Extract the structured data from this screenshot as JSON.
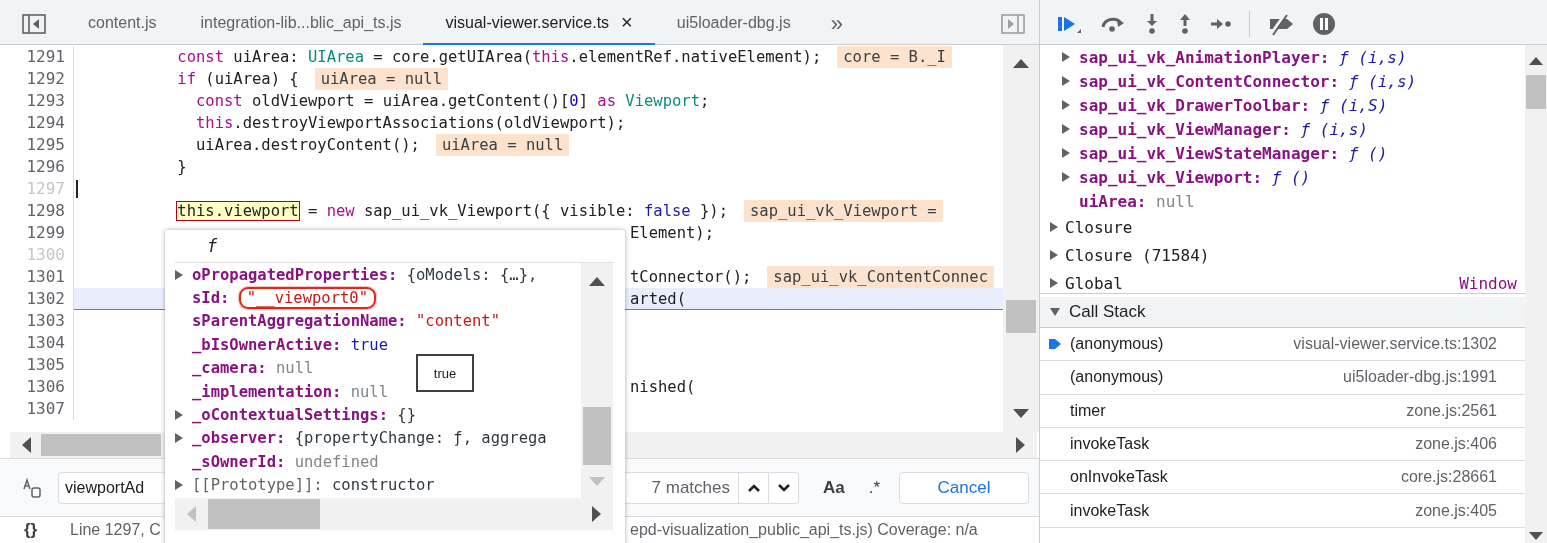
{
  "editor": {
    "tabs": [
      {
        "label": "content.js",
        "selected": false
      },
      {
        "label": "integration-lib...blic_api_ts.js",
        "selected": false
      },
      {
        "label": "visual-viewer.service.ts",
        "selected": true,
        "close": "×"
      },
      {
        "label": "ui5loader-dbg.js",
        "selected": false
      }
    ],
    "overflow": "»",
    "lines": [
      {
        "number": "1291",
        "dimmed": false,
        "current": false,
        "covered": false,
        "cursor": false,
        "tokens": [
          {
            "t": "          const",
            "kind": "kw"
          },
          {
            "t": " uiArea: ",
            "kind": "plain"
          },
          {
            "t": "UIArea",
            "kind": "type"
          },
          {
            "t": " = core.getUIArea(",
            "kind": "plain"
          },
          {
            "t": "this",
            "kind": "kw"
          },
          {
            "t": ".elementRef.nativeElement);",
            "kind": "plain"
          }
        ],
        "inline_value": "core = B._I"
      },
      {
        "number": "1292",
        "dimmed": false,
        "current": false,
        "covered": false,
        "cursor": false,
        "tokens": [
          {
            "t": "          if",
            "kind": "kw"
          },
          {
            "t": " (uiArea) {",
            "kind": "plain"
          }
        ],
        "inline_value": "uiArea = null"
      },
      {
        "number": "1293",
        "dimmed": false,
        "current": false,
        "covered": false,
        "cursor": false,
        "tokens": [
          {
            "t": "            const",
            "kind": "kw"
          },
          {
            "t": " oldViewport = uiArea.getContent()[",
            "kind": "plain"
          },
          {
            "t": "0",
            "kind": "num"
          },
          {
            "t": "] ",
            "kind": "plain"
          },
          {
            "t": "as",
            "kind": "kw"
          },
          {
            "t": " Viewport",
            "kind": "type"
          },
          {
            "t": ";",
            "kind": "plain"
          }
        ]
      },
      {
        "number": "1294",
        "dimmed": false,
        "current": false,
        "covered": false,
        "cursor": false,
        "tokens": [
          {
            "t": "            this",
            "kind": "kw"
          },
          {
            "t": ".destroyViewportAssociations(oldViewport);",
            "kind": "plain"
          }
        ]
      },
      {
        "number": "1295",
        "dimmed": false,
        "current": false,
        "covered": false,
        "cursor": false,
        "tokens": [
          {
            "t": "            uiArea.destroyContent();",
            "kind": "plain"
          }
        ],
        "inline_value": "uiArea = null"
      },
      {
        "number": "1296",
        "dimmed": false,
        "current": false,
        "covered": false,
        "cursor": false,
        "tokens": [
          {
            "t": "          }",
            "kind": "plain"
          }
        ]
      },
      {
        "number": "1297",
        "dimmed": true,
        "current": false,
        "covered": false,
        "cursor": true
      },
      {
        "number": "1298",
        "dimmed": false,
        "current": false,
        "covered": false,
        "cursor": false,
        "tokens": [
          {
            "t": "          this.viewport",
            "kind": "hl"
          },
          {
            "t": " = ",
            "kind": "plain"
          },
          {
            "t": "new",
            "kind": "kw"
          },
          {
            "t": " sap_ui_vk_Viewport({ visible: ",
            "kind": "plain"
          },
          {
            "t": "false",
            "kind": "bool"
          },
          {
            "t": " });",
            "kind": "plain"
          }
        ],
        "inline_value": "sap_ui_vk_Viewport ="
      },
      {
        "number": "1299",
        "dimmed": false,
        "current": false,
        "covered": true,
        "cursor": false,
        "tokens": [
          {
            "t": "Element);",
            "kind": "plain"
          }
        ]
      },
      {
        "number": "1300",
        "dimmed": true,
        "current": false,
        "cursor": false
      },
      {
        "number": "1301",
        "dimmed": false,
        "current": false,
        "covered": true,
        "cursor": false,
        "tokens": [
          {
            "t": "tConnector();",
            "kind": "plain"
          }
        ],
        "inline_value": "sap_ui_vk_ContentConnec"
      },
      {
        "number": "1302",
        "dimmed": false,
        "current": true,
        "covered": true,
        "cursor": false,
        "tokens": [
          {
            "t": "arted(",
            "kind": "plain"
          }
        ]
      },
      {
        "number": "1303",
        "dimmed": false,
        "current": false,
        "cursor": false
      },
      {
        "number": "1304",
        "dimmed": false,
        "current": false,
        "cursor": false
      },
      {
        "number": "1305",
        "dimmed": false,
        "current": false,
        "cursor": false
      },
      {
        "number": "1306",
        "dimmed": false,
        "current": false,
        "covered": true,
        "cursor": false,
        "tokens": [
          {
            "t": "nished(",
            "kind": "plain"
          }
        ]
      },
      {
        "number": "1307",
        "dimmed": false,
        "current": false,
        "cursor": false
      }
    ],
    "search": {
      "value": "viewportAd",
      "matches": "7 matches",
      "case_label": "Aa",
      "regex_label": ".*",
      "cancel": "Cancel"
    },
    "status": {
      "icon": "{}",
      "left": "Line 1297, C",
      "right": "epd-visualization_public_api_ts.js) Coverage: n/a"
    }
  },
  "popover": {
    "title": "f",
    "tooltip": "true",
    "rows": [
      {
        "key": "oPropagatedProperties:",
        "value": "{oModels: {…},",
        "kind": "object",
        "expandable": true,
        "circled": false,
        "internal": false
      },
      {
        "key": "sId:",
        "value": "\"__viewport0\"",
        "kind": "string",
        "expandable": false,
        "circled": true,
        "internal": false
      },
      {
        "key": "sParentAggregationName:",
        "value": "\"content\"",
        "kind": "string",
        "expandable": false,
        "circled": false,
        "internal": false
      },
      {
        "key": "_bIsOwnerActive:",
        "value": "true",
        "kind": "bool",
        "expandable": false,
        "circled": false,
        "internal": false
      },
      {
        "key": "_camera:",
        "value": "null",
        "kind": "null",
        "expandable": false,
        "circled": false,
        "internal": false
      },
      {
        "key": "_implementation:",
        "value": "null",
        "kind": "null",
        "expandable": false,
        "circled": false,
        "internal": false
      },
      {
        "key": "_oContextualSettings:",
        "value": "{}",
        "kind": "object",
        "expandable": true,
        "circled": false,
        "internal": false
      },
      {
        "key": "_observer:",
        "value": "{propertyChange: ƒ, aggrega",
        "kind": "object",
        "expandable": true,
        "circled": false,
        "internal": false
      },
      {
        "key": "_sOwnerId:",
        "value": "undefined",
        "kind": "null",
        "expandable": false,
        "circled": false,
        "internal": false
      },
      {
        "key": "[[Prototype]]:",
        "value": "constructor",
        "kind": "object",
        "expandable": true,
        "circled": false,
        "internal": true
      }
    ]
  },
  "scope": [
    {
      "children": [
        {
          "name": "sap_ui_vk_AnimationPlayer:",
          "value": "ƒ (i,s)",
          "kind": "fn",
          "expandable": true
        },
        {
          "name": "sap_ui_vk_ContentConnector:",
          "value": "ƒ (i,s)",
          "kind": "fn",
          "expandable": true
        },
        {
          "name": "sap_ui_vk_DrawerToolbar:",
          "value": "ƒ (i,S)",
          "kind": "fn",
          "expandable": true
        },
        {
          "name": "sap_ui_vk_ViewManager:",
          "value": "ƒ (i,s)",
          "kind": "fn",
          "expandable": true
        },
        {
          "name": "sap_ui_vk_ViewStateManager:",
          "value": "ƒ ()",
          "kind": "fn",
          "expandable": true
        },
        {
          "name": "sap_ui_vk_Viewport:",
          "value": "ƒ ()",
          "kind": "fn",
          "expandable": true
        },
        {
          "name": "uiArea:",
          "value": "null",
          "kind": "null",
          "expandable": false
        }
      ]
    },
    {
      "name": "Closure",
      "expandable": true
    },
    {
      "name": "Closure (71584)",
      "expandable": true
    },
    {
      "name": "Global",
      "value": "Window",
      "expandable": true
    }
  ],
  "call_stack": {
    "title": "Call Stack",
    "expanded": true,
    "frames": [
      {
        "function": "(anonymous)",
        "location": "visual-viewer.service.ts:1302",
        "selected": true
      },
      {
        "function": "(anonymous)",
        "location": "ui5loader-dbg.js:1991",
        "selected": false
      },
      {
        "function": "timer",
        "location": "zone.js:2561",
        "selected": false
      },
      {
        "function": "invokeTask",
        "location": "zone.js:406",
        "selected": false
      },
      {
        "function": "onInvokeTask",
        "location": "core.js:28661",
        "selected": false
      },
      {
        "function": "invokeTask",
        "location": "zone.js:405",
        "selected": false
      }
    ]
  }
}
